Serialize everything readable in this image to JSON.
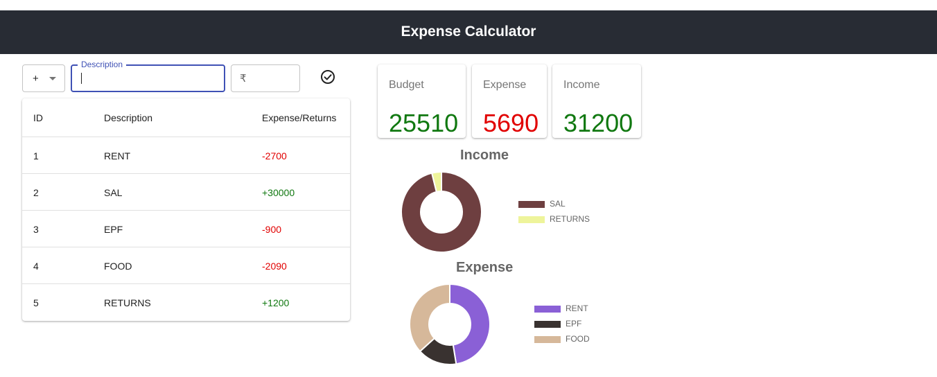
{
  "header": {
    "title": "Expense Calculator"
  },
  "form": {
    "type_value": "+",
    "description_label": "Description",
    "description_value": "",
    "currency_symbol": "₹",
    "amount_value": ""
  },
  "table": {
    "columns": [
      "ID",
      "Description",
      "Expense/Returns"
    ],
    "rows": [
      {
        "id": "1",
        "description": "RENT",
        "amount": "-2700",
        "sign": "neg"
      },
      {
        "id": "2",
        "description": "SAL",
        "amount": "+30000",
        "sign": "pos"
      },
      {
        "id": "3",
        "description": "EPF",
        "amount": "-900",
        "sign": "neg"
      },
      {
        "id": "4",
        "description": "FOOD",
        "amount": "-2090",
        "sign": "neg"
      },
      {
        "id": "5",
        "description": "RETURNS",
        "amount": "+1200",
        "sign": "pos"
      }
    ]
  },
  "stats": {
    "budget": {
      "label": "Budget",
      "value": "25510",
      "color": "#107810"
    },
    "expense": {
      "label": "Expense",
      "value": "5690",
      "color": "#e10000"
    },
    "income": {
      "label": "Income",
      "value": "31200",
      "color": "#107810"
    }
  },
  "colors": {
    "header_bg": "#282c34",
    "accent": "#3f51b5",
    "negative": "#e10000",
    "positive": "#107810"
  },
  "chart_data": [
    {
      "type": "pie",
      "title": "Income",
      "categories": [
        "SAL",
        "RETURNS"
      ],
      "values": [
        30000,
        1200
      ],
      "colors": [
        "#6e3f40",
        "#eef49b"
      ],
      "legend": "right"
    },
    {
      "type": "pie",
      "title": "Expense",
      "categories": [
        "RENT",
        "EPF",
        "FOOD"
      ],
      "values": [
        2700,
        900,
        2090
      ],
      "colors": [
        "#8a60d6",
        "#393230",
        "#d6b89a"
      ],
      "legend": "right"
    }
  ]
}
